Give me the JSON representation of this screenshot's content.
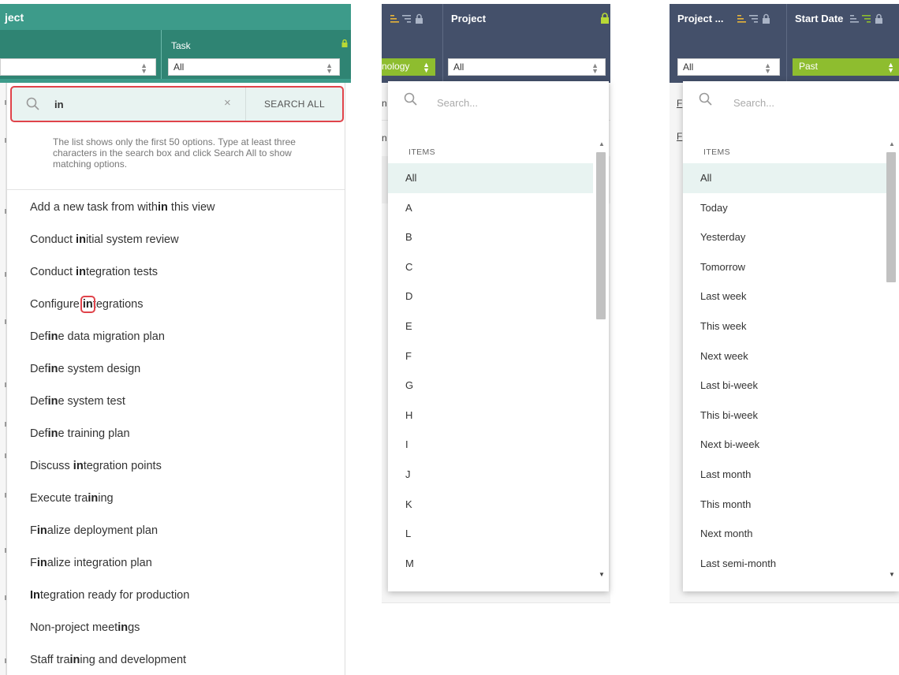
{
  "panel1": {
    "title": "ject",
    "task_label": "Task",
    "filter_value": "All",
    "search": {
      "query": "in",
      "clear": "×",
      "search_all": "SEARCH ALL",
      "hint": "The list shows only the first 50 options. Type at least three characters in the search box and click Search All to show matching options."
    },
    "items": [
      {
        "pre": "Add a new task from with",
        "match": "in",
        "post": " this view"
      },
      {
        "pre": "Conduct ",
        "match": "in",
        "post": "itial system review"
      },
      {
        "pre": "Conduct ",
        "match": "in",
        "post": "tegration tests"
      },
      {
        "pre": "Configure ",
        "match": "in",
        "post": "tegrations"
      },
      {
        "pre": "Def",
        "match": "in",
        "post": "e data migration plan"
      },
      {
        "pre": "Def",
        "match": "in",
        "post": "e system design"
      },
      {
        "pre": "Def",
        "match": "in",
        "post": "e system test"
      },
      {
        "pre": "Def",
        "match": "in",
        "post": "e training plan"
      },
      {
        "pre": "Discuss ",
        "match": "in",
        "post": "tegration points"
      },
      {
        "pre": "Execute tra",
        "match": "in",
        "post": "ing"
      },
      {
        "pre": "F",
        "match": "in",
        "post": "alize deployment plan"
      },
      {
        "pre": "F",
        "match": "in",
        "post": "alize integration plan"
      },
      {
        "pre": "",
        "match": "In",
        "post": "tegration ready for production"
      },
      {
        "pre": "Non-project meet",
        "match": "in",
        "post": "gs"
      },
      {
        "pre": "Staff tra",
        "match": "in",
        "post": "ing and development"
      }
    ]
  },
  "panel2": {
    "title": "Project",
    "green_filter": "nology",
    "filter_value": "All",
    "frag1": "n",
    "frag2": "n",
    "search_placeholder": "Search...",
    "items_label": "ITEMS",
    "items": [
      "All",
      "A",
      "B",
      "C",
      "D",
      "E",
      "F",
      "G",
      "H",
      "I",
      "J",
      "K",
      "L",
      "M"
    ]
  },
  "panel3": {
    "col1_title": "Project ...",
    "col2_title": "Start Date",
    "filter_value": "All",
    "date_filter": "Past",
    "frag1": "F",
    "frag2": "F",
    "search_placeholder": "Search...",
    "items_label": "ITEMS",
    "items": [
      "All",
      "Today",
      "Yesterday",
      "Tomorrow",
      "Last week",
      "This week",
      "Next week",
      "Last bi-week",
      "This bi-week",
      "Next bi-week",
      "Last month",
      "This month",
      "Next month",
      "Last semi-month"
    ]
  },
  "colors": {
    "green_header": "#3d9b8a",
    "dark_header": "#44506a",
    "accent_green": "#8ebd2f",
    "highlight_red": "#e0434a",
    "selected_row": "#e8f3f1"
  }
}
